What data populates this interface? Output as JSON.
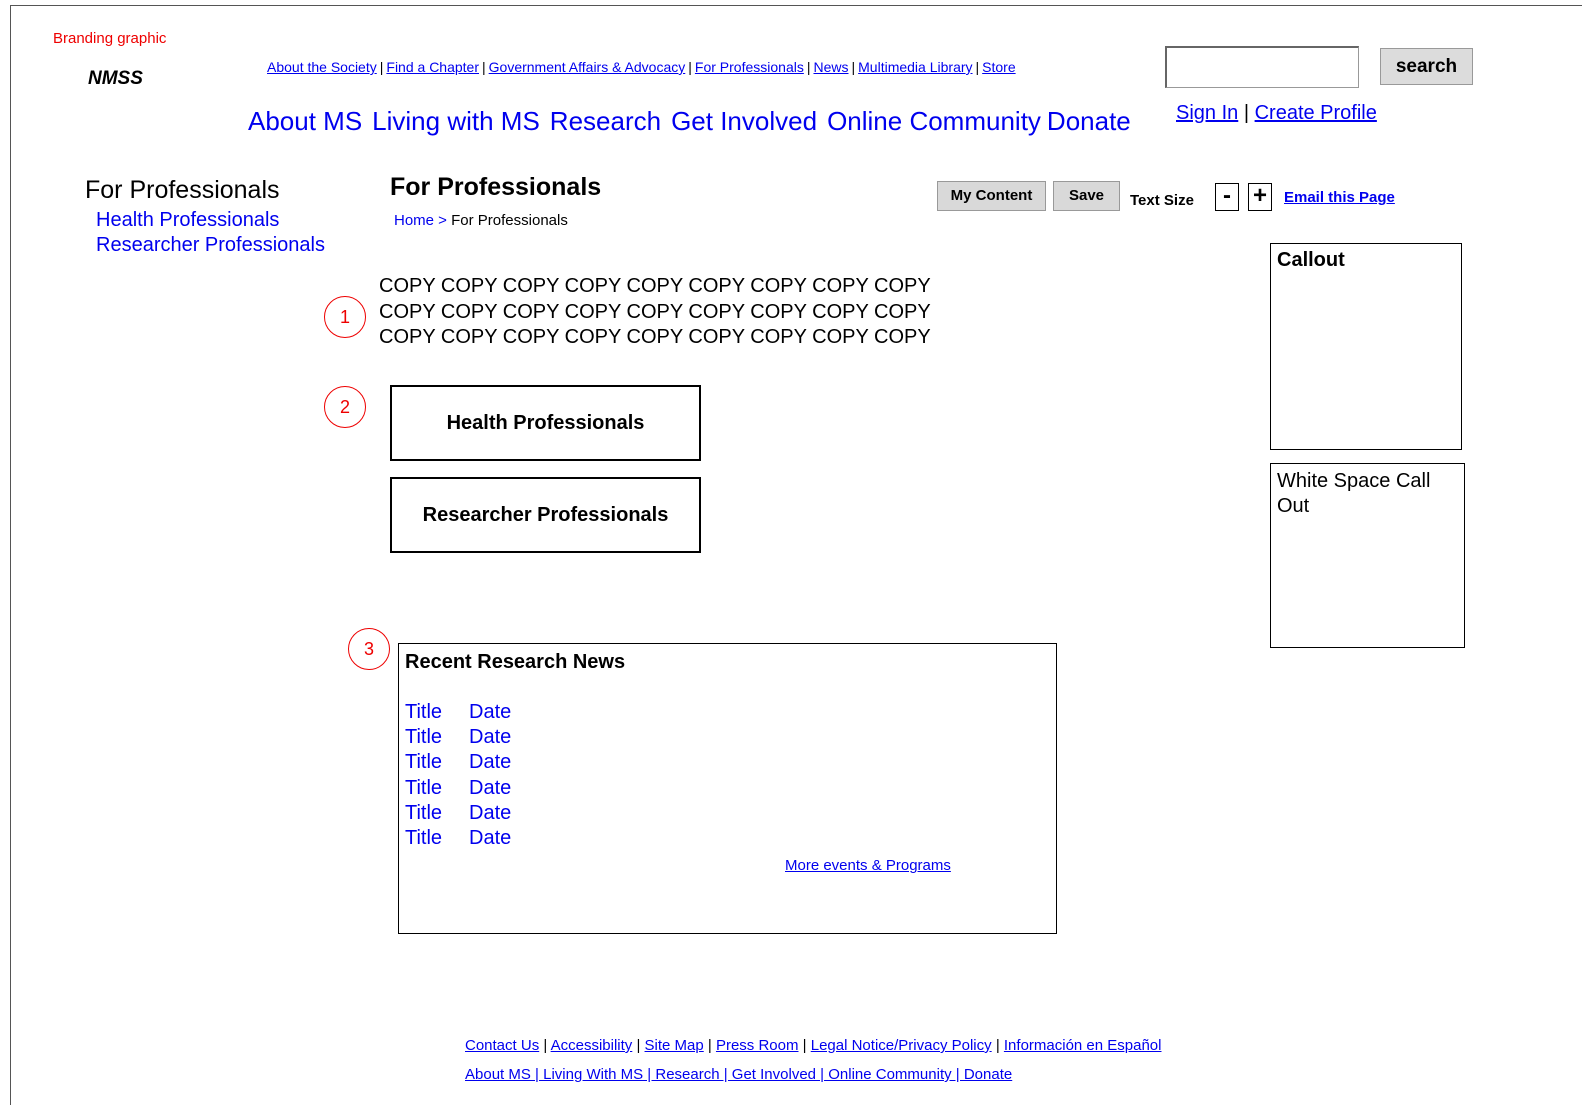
{
  "branding": {
    "label": "Branding graphic",
    "logo": "NMSS"
  },
  "util_nav": [
    "About the Society",
    "Find a Chapter",
    "Government Affairs & Advocacy",
    "For Professionals",
    "News",
    "Multimedia Library",
    "Store"
  ],
  "search": {
    "button_label": "search",
    "value": ""
  },
  "main_nav": [
    "About MS",
    "Living with MS",
    "Research",
    "Get Involved",
    "Online Community",
    "Donate"
  ],
  "account": {
    "sign_in": "Sign In",
    "separator": "|",
    "create_profile": "Create Profile"
  },
  "sidebar": {
    "title": "For Professionals",
    "items": [
      "Health Professionals",
      "Researcher Professionals"
    ]
  },
  "page": {
    "title": "For Professionals",
    "breadcrumb_home": "Home >",
    "breadcrumb_current": "For Professionals"
  },
  "tools": {
    "my_content": "My Content",
    "save": "Save",
    "text_size": "Text Size",
    "decrease": "-",
    "increase": "+",
    "email": "Email this Page"
  },
  "copy_lines": [
    "COPY COPY COPY COPY COPY COPY COPY COPY COPY",
    "COPY COPY COPY COPY COPY COPY COPY COPY COPY",
    "COPY COPY COPY COPY COPY COPY COPY COPY COPY"
  ],
  "markers": [
    "1",
    "2",
    "3"
  ],
  "professional_buttons": [
    "Health Professionals",
    "Researcher Professionals"
  ],
  "news": {
    "title": "Recent Research News",
    "rows": [
      {
        "title": "Title",
        "date": "Date"
      },
      {
        "title": "Title",
        "date": "Date"
      },
      {
        "title": "Title",
        "date": "Date"
      },
      {
        "title": "Title",
        "date": "Date"
      },
      {
        "title": "Title",
        "date": "Date"
      },
      {
        "title": "Title",
        "date": "Date"
      }
    ],
    "more": "More events & Programs"
  },
  "callout": {
    "label": "Callout"
  },
  "white_space_callout": {
    "label": "White Space Call Out"
  },
  "footer": {
    "row1": [
      "Contact Us",
      "Accessibility",
      "Site Map",
      "Press Room",
      "Legal Notice/Privacy Policy",
      "Información en Español"
    ],
    "row2": "About MS | Living With MS | Research | Get Involved | Online Community | Donate"
  },
  "colors": {
    "link": "#0000ee",
    "annotation": "#ee0000",
    "button_bg": "#d9d9d9"
  }
}
